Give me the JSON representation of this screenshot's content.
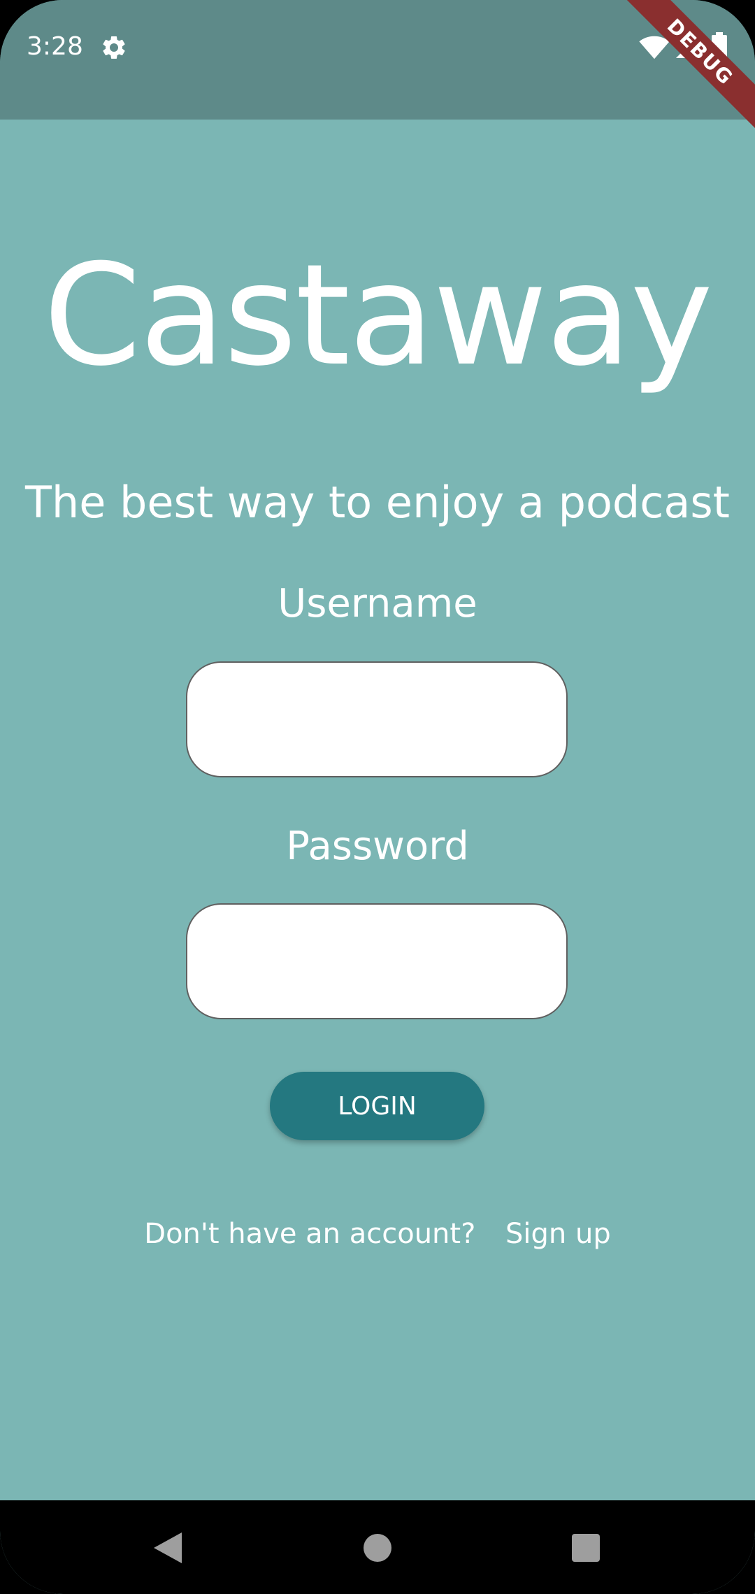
{
  "status_bar": {
    "time": "3:28",
    "icons": [
      "gear-icon",
      "wifi-icon",
      "signal-icon",
      "battery-icon"
    ]
  },
  "debug_banner": {
    "label": "DEBUG"
  },
  "app": {
    "title": "Castaway",
    "tagline": "The best way to enjoy a podcast"
  },
  "login_form": {
    "username_label": "Username",
    "username_value": "",
    "password_label": "Password",
    "password_value": "",
    "login_button": "LOGIN"
  },
  "signup": {
    "prompt": "Don't have an account?",
    "link": "Sign up"
  },
  "nav_bar": {
    "icons": [
      "back-icon",
      "home-icon",
      "recents-icon"
    ]
  },
  "colors": {
    "background": "#7bb6b4",
    "status_bar": "#5e8a89",
    "accent_button": "#247880",
    "debug_ribbon": "#8a2f2f",
    "text": "#ffffff"
  }
}
